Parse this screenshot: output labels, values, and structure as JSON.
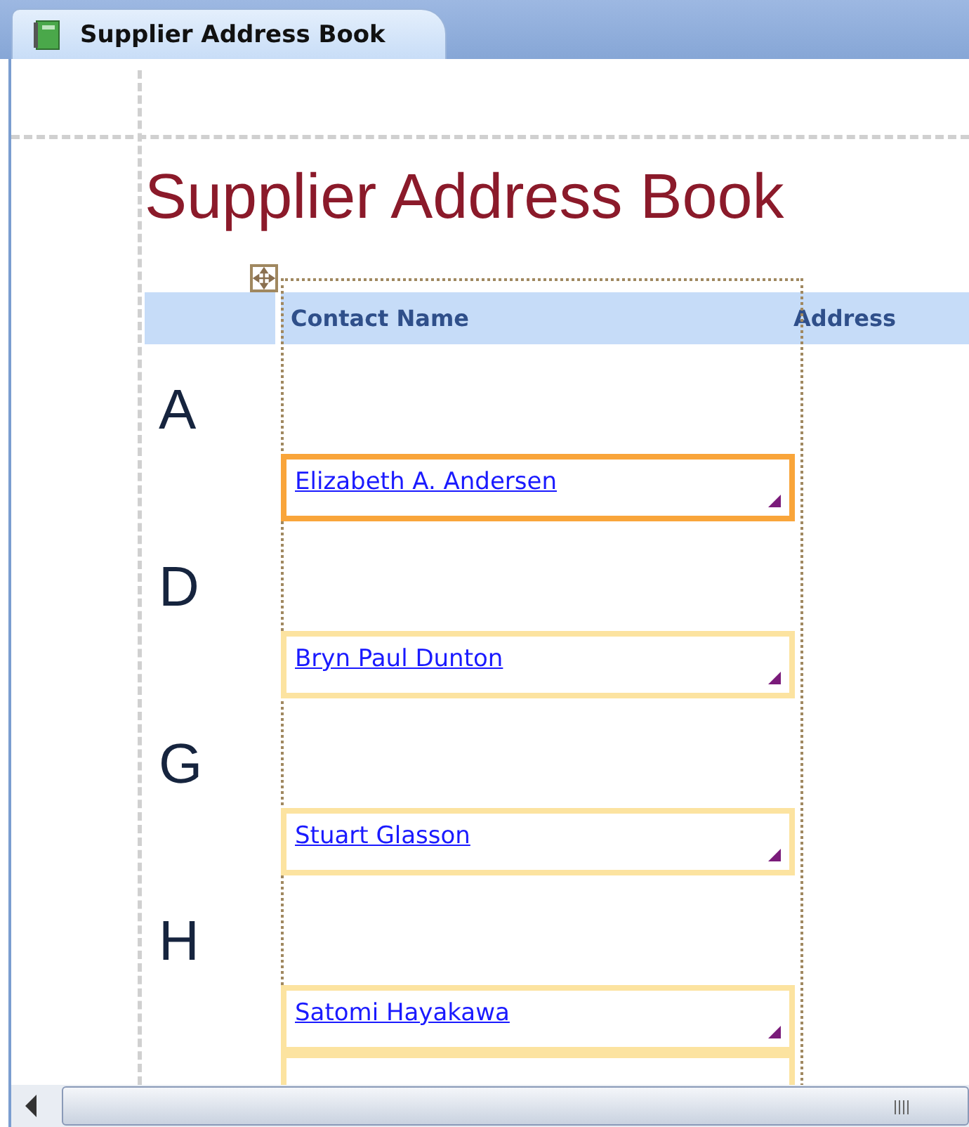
{
  "tab": {
    "title": "Supplier Address Book",
    "selected": true
  },
  "report": {
    "title": "Supplier Address Book",
    "columns": [
      "Contact Name",
      "Address"
    ],
    "groups": [
      {
        "letter": "A",
        "contacts": [
          {
            "name": "Elizabeth A. Andersen",
            "selected": true
          }
        ]
      },
      {
        "letter": "D",
        "contacts": [
          {
            "name": "Bryn Paul Dunton",
            "selected": false
          }
        ]
      },
      {
        "letter": "G",
        "contacts": [
          {
            "name": "Stuart Glasson",
            "selected": false
          }
        ]
      },
      {
        "letter": "H",
        "contacts": [
          {
            "name": "Satomi Hayakawa",
            "selected": false
          },
          {
            "selected": false
          }
        ]
      }
    ]
  }
}
